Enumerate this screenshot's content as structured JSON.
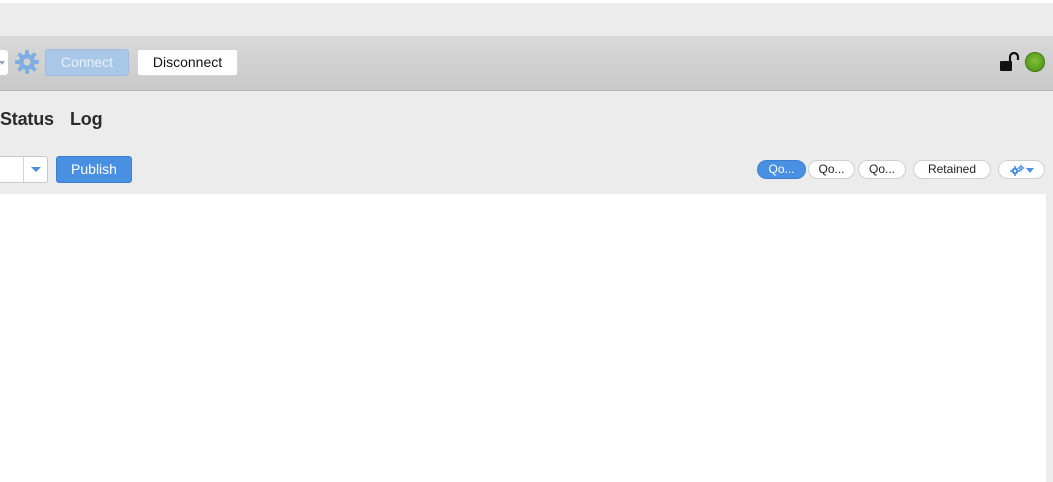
{
  "toolbar": {
    "connect_label": "Connect",
    "disconnect_label": "Disconnect",
    "connection_status_color": "#6aad2a"
  },
  "tabs": [
    {
      "label": "Status"
    },
    {
      "label": "Log"
    }
  ],
  "publish": {
    "topic_value": "",
    "publish_label": "Publish",
    "qos_options": [
      {
        "label": "Qo...",
        "selected": true
      },
      {
        "label": "Qo...",
        "selected": false
      },
      {
        "label": "Qo...",
        "selected": false
      }
    ],
    "retained_label": "Retained"
  },
  "colors": {
    "accent": "#4a90e2",
    "accent_disabled": "#a9c8e8"
  }
}
